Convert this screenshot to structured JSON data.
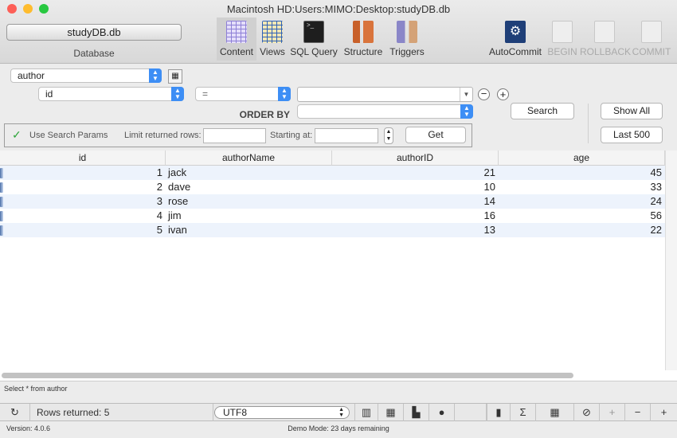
{
  "window": {
    "title": "Macintosh HD:Users:MIMO:Desktop:studyDB.db"
  },
  "database": {
    "button": "studyDB.db",
    "label": "Database"
  },
  "toolbar": {
    "tabs": [
      {
        "label": "Content",
        "icon": "content-grid-icon",
        "selected": true
      },
      {
        "label": "Views",
        "icon": "views-grid-icon"
      },
      {
        "label": "SQL Query",
        "icon": "terminal-icon"
      },
      {
        "label": "Structure",
        "icon": "structure-icon"
      },
      {
        "label": "Triggers",
        "icon": "triggers-icon"
      }
    ],
    "transactions": [
      {
        "label": "AutoCommit",
        "icon": "autocommit-icon",
        "enabled": true
      },
      {
        "label": "BEGIN",
        "icon": "begin-icon",
        "enabled": false
      },
      {
        "label": "ROLLBACK",
        "icon": "rollback-icon",
        "enabled": false
      },
      {
        "label": "COMMIT",
        "icon": "commit-icon",
        "enabled": false
      }
    ]
  },
  "search": {
    "table": "author",
    "field": "id",
    "operator": "=",
    "value": "",
    "order_by_label": "ORDER BY",
    "order_by": "",
    "search_button": "Search",
    "show_all_button": "Show All",
    "last500_button": "Last 500",
    "use_search_params": "Use Search Params",
    "use_search_params_checked": true,
    "limit_label": "Limit returned rows:",
    "limit_value": "",
    "starting_label": "Starting at:",
    "starting_value": "",
    "get_button": "Get"
  },
  "table": {
    "columns": [
      "id",
      "authorName",
      "authorID",
      "age"
    ],
    "rows": [
      [
        "1",
        "jack",
        "21",
        "45"
      ],
      [
        "2",
        "dave",
        "10",
        "33"
      ],
      [
        "3",
        "rose",
        "14",
        "24"
      ],
      [
        "4",
        "jim",
        "16",
        "56"
      ],
      [
        "5",
        "ivan",
        "13",
        "22"
      ]
    ]
  },
  "query_text": "Select * from author",
  "bottombar": {
    "rows_returned": "Rows returned: 5",
    "encoding": "UTF8"
  },
  "status": {
    "version": "Version: 4.0.6",
    "demo": "Demo Mode: 23 days remaining"
  },
  "colors": {
    "accent": "#3d8ef5",
    "row_alt": "#edf3fc"
  }
}
